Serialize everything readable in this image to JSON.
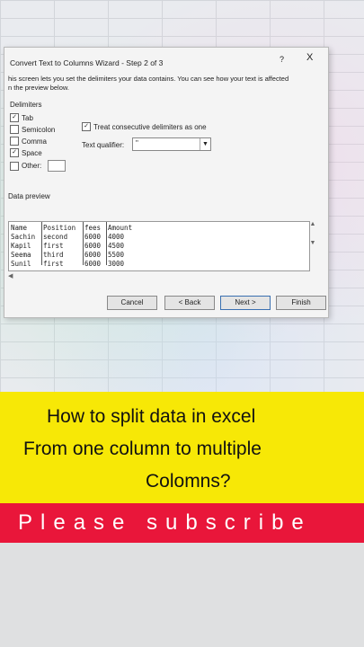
{
  "dialog": {
    "title": "Convert Text to Columns Wizard - Step 2 of 3",
    "help": "?",
    "close": "X",
    "desc_line1": "his screen lets you set the delimiters your data contains.  You can see how your text is affected",
    "desc_line2": "n the preview below.",
    "delimiters_label": "Delimiters",
    "tab_label": "Tab",
    "semicolon_label": "Semicolon",
    "comma_label": "Comma",
    "space_label": "Space",
    "other_label": "Other:",
    "tab_checked": true,
    "semicolon_checked": false,
    "comma_checked": false,
    "space_checked": true,
    "other_checked": false,
    "treat_label": "Treat consecutive delimiters as one",
    "treat_checked": true,
    "qualifier_label": "Text qualifier:",
    "qualifier_value": "\"",
    "data_preview_label": "Data preview",
    "preview": {
      "headers": [
        "Name",
        "Position",
        "fees",
        "Amount"
      ],
      "rows": [
        [
          "Sachin",
          "second",
          "6000",
          "4000"
        ],
        [
          "Kapil",
          "first",
          "6000",
          "4500"
        ],
        [
          "Seema",
          "third",
          "6000",
          "5500"
        ],
        [
          "Sunil",
          "first",
          "6000",
          "3000"
        ]
      ]
    },
    "buttons": {
      "cancel": "Cancel",
      "back": "< Back",
      "next": "Next >",
      "finish": "Finish"
    }
  },
  "caption": {
    "line1": "How to split data in excel",
    "line2": "From one column to multiple",
    "line3": "Colomns?"
  },
  "banner": "Please subscribe",
  "colors": {
    "yellow": "#f7e806",
    "red": "#e9163a"
  }
}
